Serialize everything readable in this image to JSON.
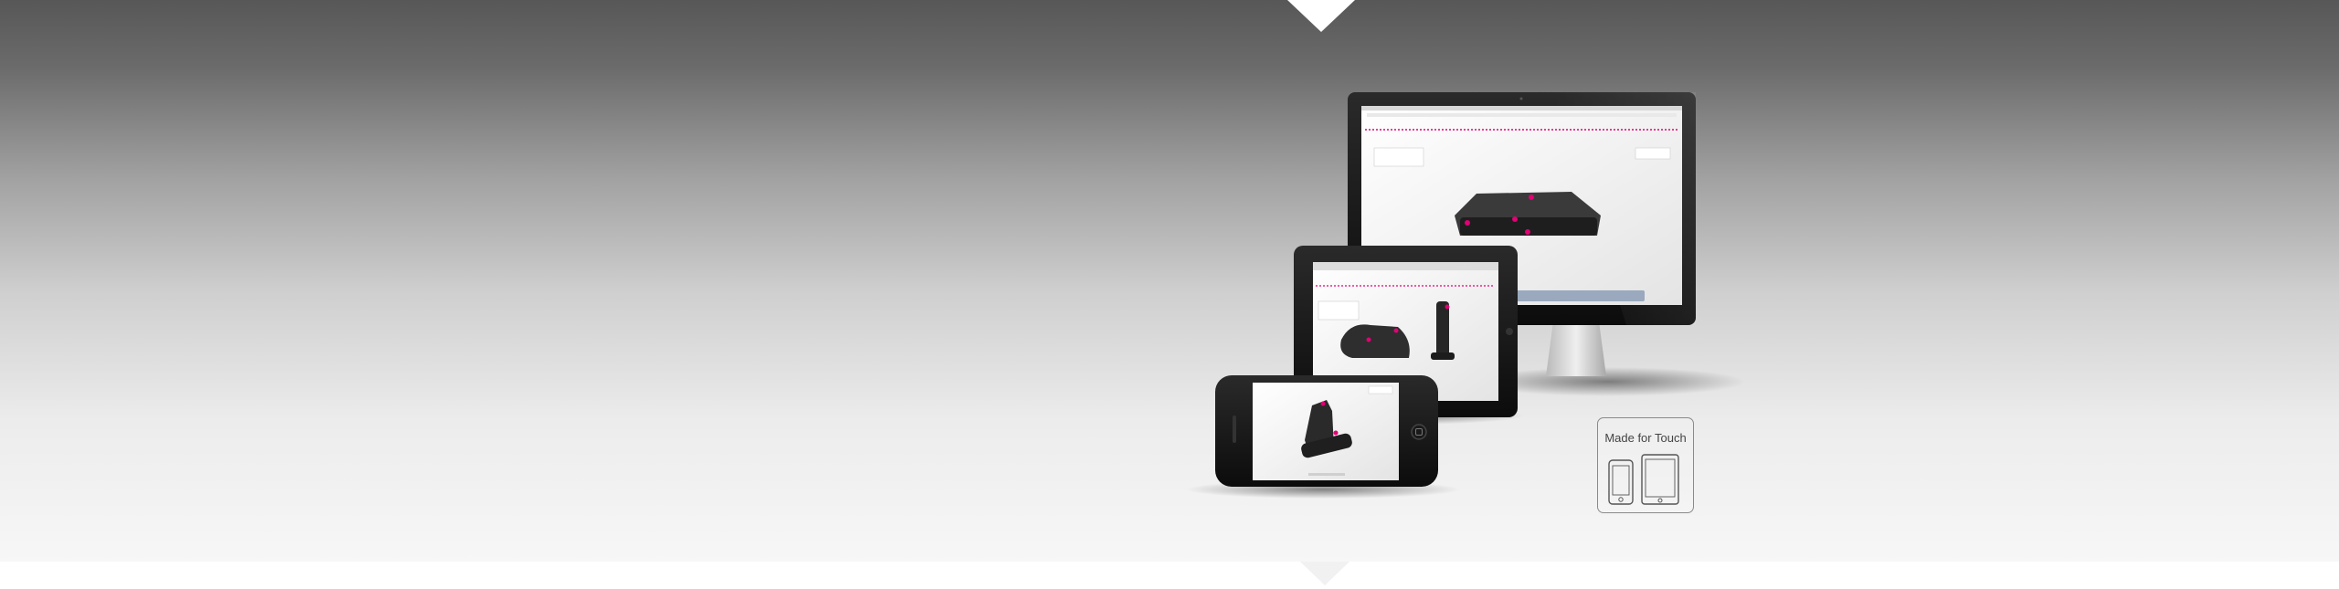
{
  "badge": {
    "label": "Made for Touch",
    "icons": [
      "smartphone-icon",
      "tablet-icon"
    ]
  },
  "colors": {
    "accent": "#e20074",
    "background_top": "#575757",
    "background_bottom": "#f7f7f7"
  },
  "devices": [
    "desktop-monitor",
    "tablet",
    "smartphone"
  ]
}
